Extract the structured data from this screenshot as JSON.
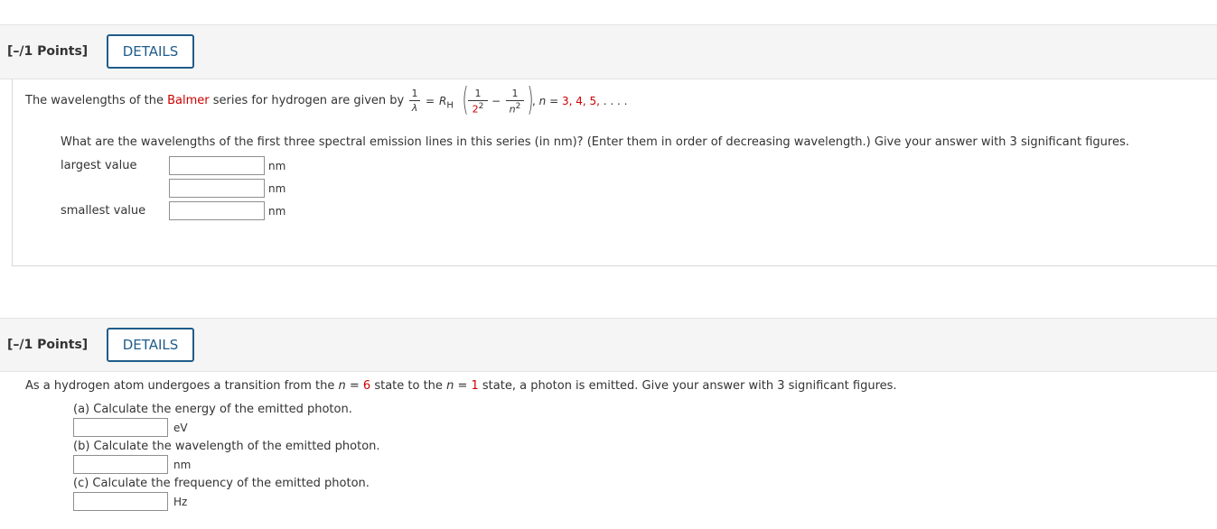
{
  "q1": {
    "points": "[–/1 Points]",
    "details": "DETAILS",
    "intro_before": "The wavelengths of the ",
    "intro_link": "Balmer",
    "intro_after": " series for hydrogen are given by",
    "eq_one": "1",
    "eq_lambda": "λ",
    "eq_equals": "=",
    "eq_R": "R",
    "eq_sub": "H",
    "eq_two": "2",
    "eq_exp": "2",
    "eq_minus": "−",
    "eq_n": "n",
    "eq_n_exp": "2",
    "eq_tail_pre": ", ",
    "eq_tail_n": "n",
    "eq_tail_eq": " = ",
    "eq_tail_vals": "3, 4, 5,",
    "eq_tail_dots": " . . . .",
    "question": "What are the wavelengths of the first three spectral emission lines in this series (in nm)? (Enter them in order of decreasing wavelength.) Give your answer with 3 significant figures.",
    "label_largest": "largest value",
    "label_smallest": "smallest value",
    "unit": "nm",
    "values": [
      "",
      "",
      ""
    ]
  },
  "q2": {
    "points": "[–/1 Points]",
    "details": "DETAILS",
    "s1": "As a hydrogen atom undergoes a transition from the ",
    "n": "n",
    "eq": " = ",
    "v1": "6",
    "s2": " state to the ",
    "v2": "1",
    "s3": " state, a photon is emitted. Give your answer with 3 significant figures.",
    "a_label": "(a) Calculate the energy of the emitted photon.",
    "a_unit": "eV",
    "b_label": "(b) Calculate the wavelength of the emitted photon.",
    "b_unit": "nm",
    "c_label": "(c) Calculate the frequency of the emitted photon.",
    "c_unit": "Hz",
    "values": [
      "",
      "",
      ""
    ]
  },
  "colors": {
    "accent": "#1f5c8b",
    "highlight": "#cc0000",
    "header_bg": "#f5f5f5"
  }
}
